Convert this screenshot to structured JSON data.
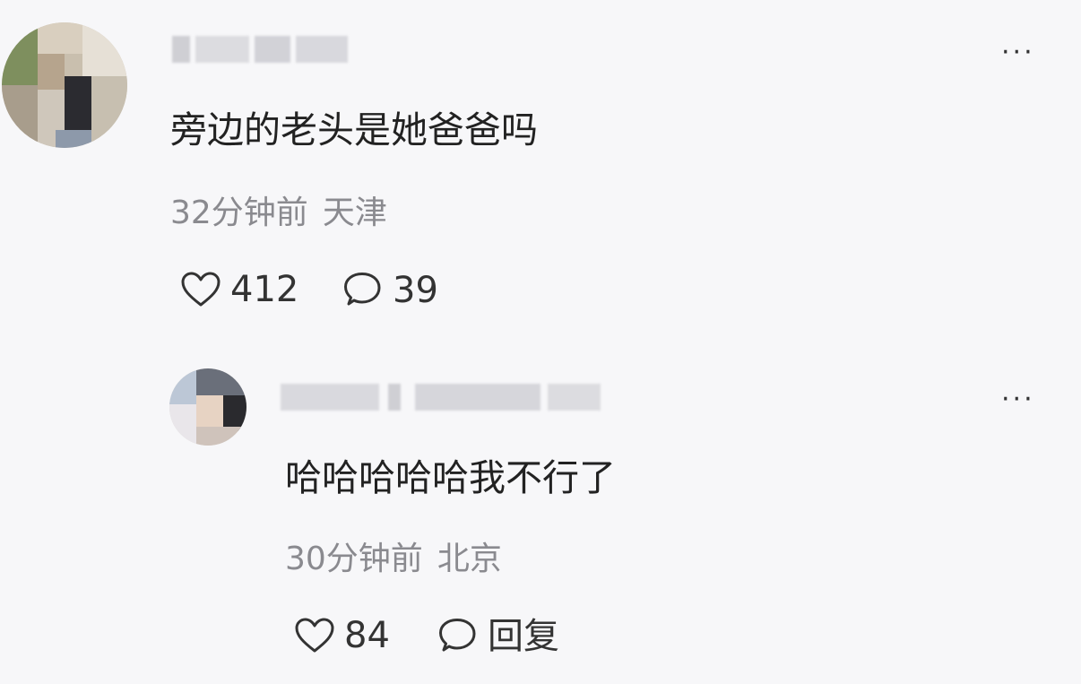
{
  "comment": {
    "text": "旁边的老头是她爸爸吗",
    "time": "32分钟前",
    "location": "天津",
    "likes": "412",
    "replies": "39",
    "more_label": "···"
  },
  "reply": {
    "text": "哈哈哈哈哈我不行了",
    "time": "30分钟前",
    "location": "北京",
    "likes": "84",
    "reply_label": "回复",
    "more_label": "···"
  }
}
